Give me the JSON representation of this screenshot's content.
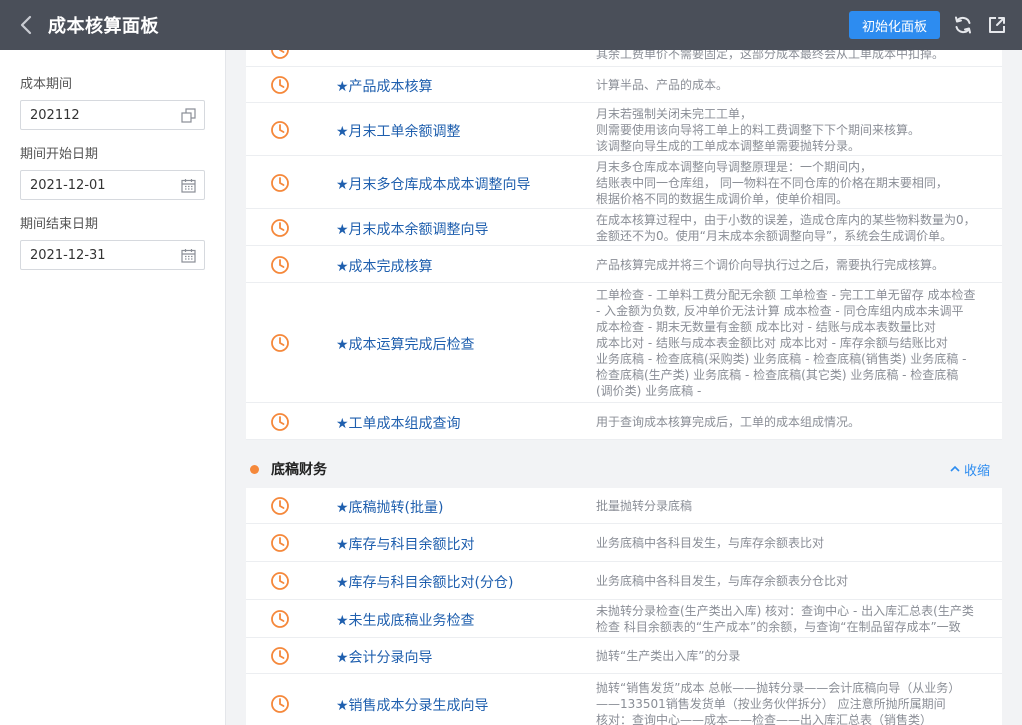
{
  "header": {
    "title": "成本核算面板",
    "init_button": "初始化面板"
  },
  "left": {
    "period_label": "成本期间",
    "period_value": "202112",
    "start_label": "期间开始日期",
    "start_value": "2021-12-01",
    "end_label": "期间结束日期",
    "end_value": "2021-12-31"
  },
  "section1": {
    "top_partial_desc": "其余工费单价不需要固定，这部分成本最终会从工单成本中扣掉。",
    "items": [
      {
        "name": "★产品成本核算",
        "desc": [
          "计算半品、产品的成本。"
        ]
      },
      {
        "name": "★月末工单余额调整",
        "desc": [
          "月末若强制关闭未完工工单，",
          "则需要使用该向导将工单上的料工费调整下下个期间来核算。",
          "该调整向导生成的工单成本调整单需要抛转分录。"
        ]
      },
      {
        "name": "★月末多仓库成本成本调整向导",
        "desc": [
          "月末多仓库成本调整向导调整原理是：一个期间内，",
          "结账表中同一仓库组， 同一物料在不同仓库的价格在期末要相同，",
          "根据价格不同的数据生成调价单，使单价相同。"
        ]
      },
      {
        "name": "★月末成本余额调整向导",
        "desc": [
          "在成本核算过程中，由于小数的误差，造成仓库内的某些物料数量为0，",
          "金额还不为0。使用“月末成本余额调整向导”，系统会生成调价单。"
        ]
      },
      {
        "name": "★成本完成核算",
        "desc": [
          "产品核算完成并将三个调价向导执行过之后，需要执行完成核算。"
        ]
      },
      {
        "name": "★成本运算完成后检查",
        "desc": [
          "工单检查 - 工单料工费分配无余额 工单检查 - 完工工单无留存 成本检查",
          "- 入金额为负数, 反冲单价无法计算 成本检查 - 同仓库组内成本未调平",
          "成本检查 - 期末无数量有金额 成本比对 - 结账与成本表数量比对",
          "成本比对 - 结账与成本表金额比对 成本比对 - 库存余额与结账比对",
          "业务底稿 - 检查底稿(采购类) 业务底稿 - 检查底稿(销售类) 业务底稿 -",
          "检查底稿(生产类) 业务底稿 - 检查底稿(其它类) 业务底稿 - 检查底稿",
          "(调价类) 业务底稿 -"
        ]
      },
      {
        "name": "★工单成本组成查询",
        "desc": [
          "用于查询成本核算完成后，工单的成本组成情况。"
        ]
      }
    ]
  },
  "section2": {
    "title": "底稿财务",
    "collapse": "收缩",
    "items": [
      {
        "name": "★底稿抛转(批量)",
        "desc": [
          "批量抛转分录底稿"
        ]
      },
      {
        "name": "★库存与科目余额比对",
        "desc": [
          "业务底稿中各科目发生，与库存余额表比对"
        ]
      },
      {
        "name": "★库存与科目余额比对(分仓)",
        "desc": [
          "业务底稿中各科目发生，与库存余额表分仓比对"
        ]
      },
      {
        "name": "★未生成底稿业务检查",
        "desc": [
          "未抛转分录检查(生产类出入库) 核对：查询中心 - 出入库汇总表(生产类",
          "检查 科目余额表的“生产成本”的余额，与查询“在制品留存成本”一致"
        ]
      },
      {
        "name": "★会计分录向导",
        "desc": [
          "抛转“生产类出入库”的分录"
        ]
      },
      {
        "name": "★销售成本分录生成向导",
        "desc": [
          "抛转“销售发货”成本 总帐——抛转分录——会计底稿向导（从业务）",
          "——133501销售发货单（按业务伙伴拆分） 应注意所抛所属期间",
          "核对：查询中心——成本——检查——出入库汇总表（销售类）"
        ]
      }
    ]
  },
  "colors": {
    "accent": "#2d8cf0",
    "header_bg": "#4a4f59",
    "clock_orange": "#f5883b",
    "link_blue": "#1f5fae"
  },
  "icons": [
    "chevron-left-icon",
    "refresh-icon",
    "export-icon",
    "copy-icon",
    "calendar-icon",
    "clock-icon",
    "chevron-up-icon"
  ]
}
